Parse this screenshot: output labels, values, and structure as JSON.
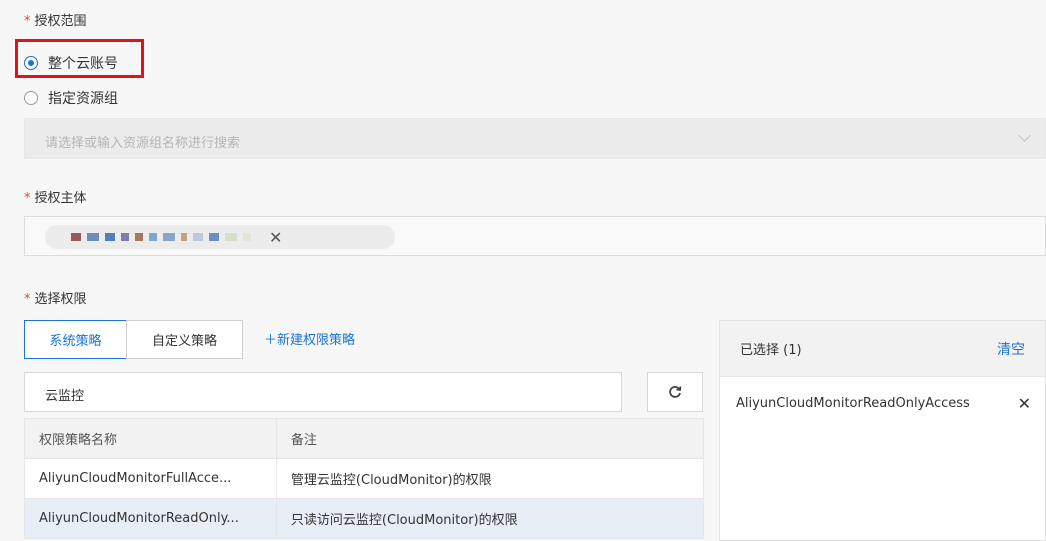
{
  "scope": {
    "label": "授权范围",
    "options": [
      {
        "label": "整个云账号",
        "checked": true
      },
      {
        "label": "指定资源组",
        "checked": false
      }
    ],
    "resource_group_placeholder": "请选择或输入资源组名称进行搜索"
  },
  "principal": {
    "label": "授权主体",
    "close_glyph": "✕"
  },
  "permissions": {
    "label": "选择权限",
    "tabs": [
      {
        "label": "系统策略",
        "active": true
      },
      {
        "label": "自定义策略",
        "active": false
      }
    ],
    "new_policy_link": "＋新建权限策略",
    "search_value": "云监控",
    "table": {
      "headers": [
        "权限策略名称",
        "备注"
      ],
      "rows": [
        [
          "AliyunCloudMonitorFullAcce...",
          "管理云监控(CloudMonitor)的权限"
        ],
        [
          "AliyunCloudMonitorReadOnly...",
          "只读访问云监控(CloudMonitor)的权限"
        ]
      ]
    }
  },
  "selected_panel": {
    "title": "已选择 (1)",
    "clear_label": "清空",
    "items": [
      "AliyunCloudMonitorReadOnlyAccess"
    ],
    "remove_glyph": "✕"
  },
  "colors": {
    "accent": "#1a73d9",
    "required": "#e8403f",
    "highlight": "#e0121a"
  },
  "icons": [
    "radio-checked-icon",
    "radio-unchecked-icon",
    "chevron-down-icon",
    "close-icon",
    "refresh-icon",
    "plus-icon"
  ]
}
